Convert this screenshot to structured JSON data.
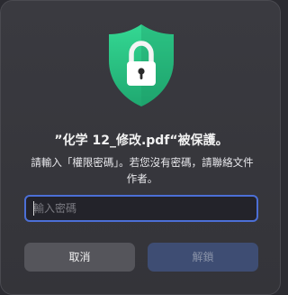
{
  "dialog": {
    "title": "”化学 12_修改.pdf“被保護。",
    "message": "請輸入「權限密碼」。若您沒有密碼，請聯絡文件作者。",
    "password_placeholder": "輸入密碼",
    "password_value": "",
    "cancel_label": "取消",
    "unlock_label": "解鎖",
    "icon": "shield-lock-icon"
  },
  "colors": {
    "shield_light": "#2fd28e",
    "shield_dark": "#1fa870",
    "lock_body": "#ffffff",
    "input_focus": "#4c6fd6",
    "unlock_disabled_bg": "#3e4d73"
  }
}
